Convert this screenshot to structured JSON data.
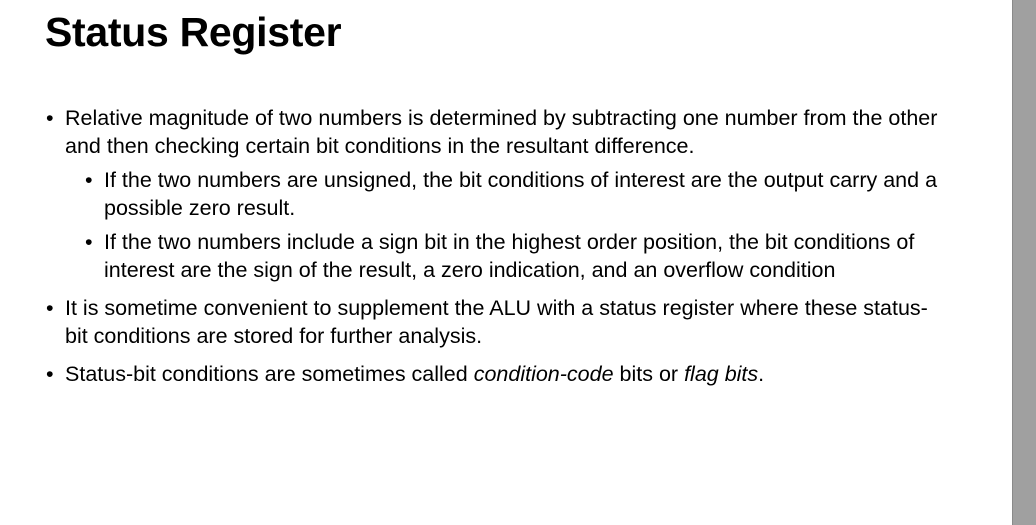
{
  "slide": {
    "title": "Status Register",
    "bullet_glyph": "•",
    "bullets": [
      {
        "text": "Relative magnitude of two numbers is determined by subtracting one number from the other and then checking certain bit conditions in the resultant difference.",
        "subbullets": [
          "If the two numbers are unsigned, the bit conditions of interest are the output carry and a possible zero result.",
          "If the two numbers include a sign bit in the highest order position, the bit conditions of interest are the sign of the result, a zero indication, and an overflow condition"
        ]
      },
      {
        "text": "It is sometime convenient to supplement the ALU with a status register where these status-bit conditions are stored for  further analysis."
      },
      {
        "text_pre": "Status-bit conditions are sometimes called ",
        "em1": "condition-code",
        "text_mid": " bits or ",
        "em2": "flag bits",
        "text_post": "."
      }
    ]
  }
}
